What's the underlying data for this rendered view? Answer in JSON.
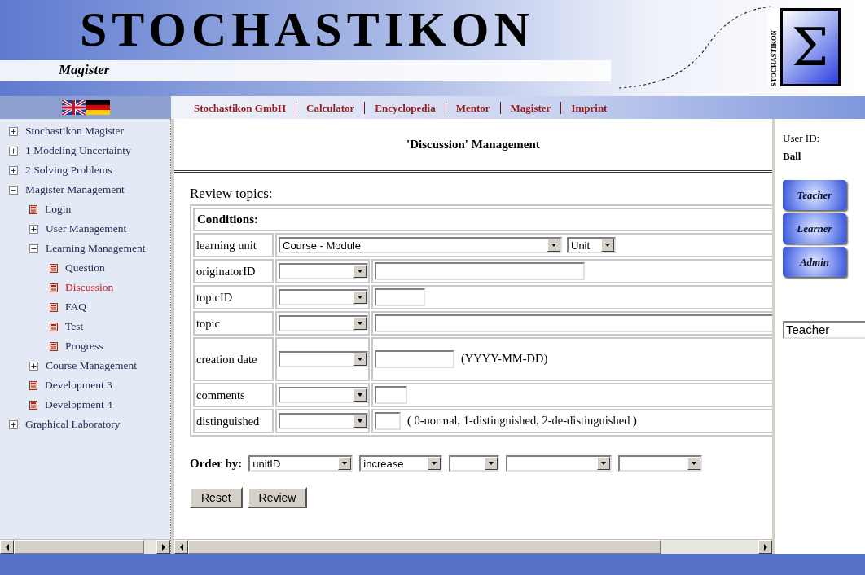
{
  "header": {
    "title": "STOCHASTIKON",
    "subtitle": "Magister",
    "logo": {
      "vertical_text": "STOCHASTIKON",
      "symbol": "Σ"
    }
  },
  "nav": {
    "links": [
      "Stochastikon GmbH",
      "Calculator",
      "Encyclopedia",
      "Mentor",
      "Magister",
      "Imprint"
    ]
  },
  "sidebar": {
    "items": [
      {
        "label": "Stochastikon Magister",
        "kind": "folder",
        "expanded": false
      },
      {
        "label": "1 Modeling Uncertainty",
        "kind": "folder",
        "expanded": false
      },
      {
        "label": "2 Solving Problems",
        "kind": "folder",
        "expanded": false
      },
      {
        "label": "Magister Management",
        "kind": "folder",
        "expanded": true,
        "children": [
          {
            "label": "Login",
            "kind": "page",
            "selected": false
          },
          {
            "label": "User Management",
            "kind": "folder",
            "expanded": false
          },
          {
            "label": "Learning Management",
            "kind": "folder",
            "expanded": true,
            "children": [
              {
                "label": "Question",
                "kind": "page",
                "selected": false
              },
              {
                "label": "Discussion",
                "kind": "page",
                "selected": true
              },
              {
                "label": "FAQ",
                "kind": "page",
                "selected": false
              },
              {
                "label": "Test",
                "kind": "page",
                "selected": false
              },
              {
                "label": "Progress",
                "kind": "page",
                "selected": false
              }
            ]
          },
          {
            "label": "Course Management",
            "kind": "folder",
            "expanded": false
          },
          {
            "label": "Development 3",
            "kind": "page",
            "selected": false
          },
          {
            "label": "Development 4",
            "kind": "page",
            "selected": false
          }
        ]
      },
      {
        "label": "Graphical Laboratory",
        "kind": "folder",
        "expanded": false
      }
    ]
  },
  "main": {
    "title": "'Discussion' Management",
    "section": "Review topics:",
    "conditions_heading": "Conditions:",
    "conditions": [
      {
        "label": "learning unit",
        "kind": "unit",
        "selects": [
          {
            "kind": "select",
            "value": "Course - Module"
          },
          {
            "kind": "select",
            "value": "Unit"
          }
        ]
      },
      {
        "label": "originatorID",
        "kind": "filter"
      },
      {
        "label": "topicID",
        "kind": "filter"
      },
      {
        "label": "topic",
        "kind": "filter"
      },
      {
        "label": "creation date",
        "kind": "filter",
        "hint": "(YYYY-MM-DD)"
      },
      {
        "label": "comments",
        "kind": "filter"
      },
      {
        "label": "distinguished",
        "kind": "filter",
        "hint": "( 0-normal, 1-distinguished, 2-de-distinguished )"
      }
    ],
    "order_by": {
      "label": "Order by:",
      "selects": [
        {
          "kind": "select",
          "value": "unitID"
        },
        {
          "kind": "select",
          "value": "increase"
        },
        {
          "kind": "select"
        },
        {
          "kind": "select"
        },
        {
          "kind": "select"
        }
      ]
    },
    "buttons": [
      "Reset",
      "Review"
    ]
  },
  "user_panel": {
    "label": "User ID:",
    "user": "Ball",
    "roles": [
      "Teacher",
      "Learner",
      "Admin"
    ],
    "role_field": {
      "value": "Teacher"
    }
  }
}
